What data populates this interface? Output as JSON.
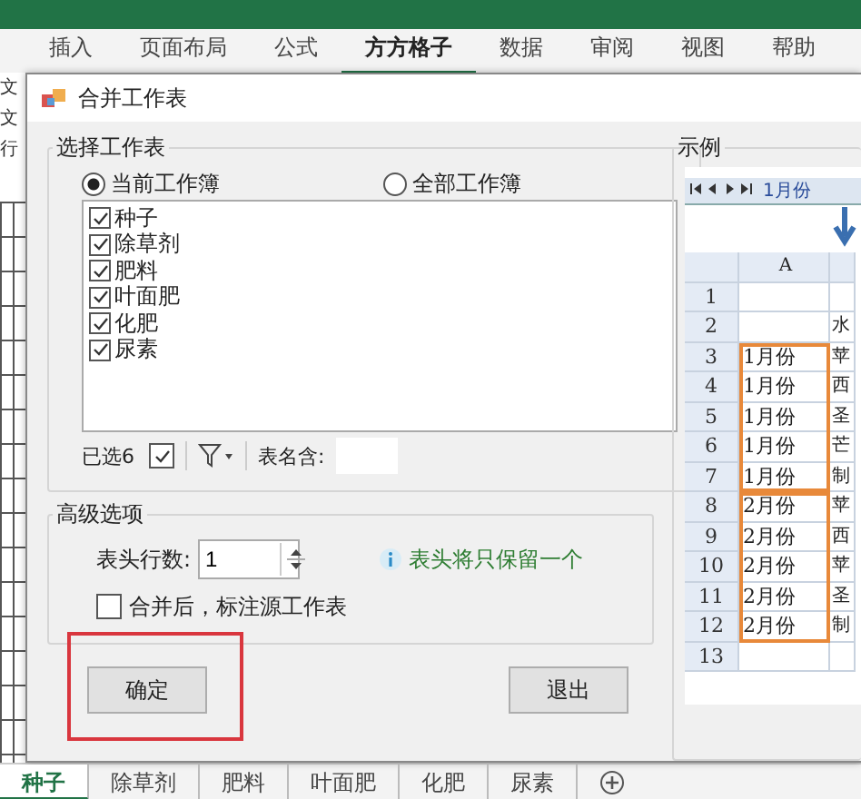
{
  "ribbon_tabs": [
    {
      "label": "插入",
      "selected": false
    },
    {
      "label": "页面布局",
      "selected": false
    },
    {
      "label": "公式",
      "selected": false
    },
    {
      "label": "方方格子",
      "selected": true
    },
    {
      "label": "数据",
      "selected": false
    },
    {
      "label": "审阅",
      "selected": false
    },
    {
      "label": "视图",
      "selected": false
    },
    {
      "label": "帮助",
      "selected": false
    }
  ],
  "side_chars": [
    "文",
    "文",
    "行"
  ],
  "dialog": {
    "title": "合并工作表",
    "select_group": {
      "title": "选择工作表",
      "scopes": [
        {
          "label": "当前工作簿",
          "selected": true
        },
        {
          "label": "全部工作簿",
          "selected": false
        }
      ],
      "sheets": [
        {
          "label": "种子",
          "checked": true
        },
        {
          "label": "除草剂",
          "checked": true
        },
        {
          "label": "肥料",
          "checked": true
        },
        {
          "label": "叶面肥",
          "checked": true
        },
        {
          "label": "化肥",
          "checked": true
        },
        {
          "label": "尿素",
          "checked": true
        }
      ],
      "selected_count": "已选6",
      "select_all_checked": true,
      "name_filter_label": "表名含:"
    },
    "advanced_group": {
      "title": "高级选项",
      "header_rows_label": "表头行数:",
      "header_rows_value": "1",
      "hint": "表头将只保留一个",
      "mark_source_label": "合并后，标注源工作表",
      "mark_source_checked": false
    },
    "buttons": [
      {
        "label": "确定",
        "highlighted": true
      },
      {
        "label": "退出",
        "highlighted": false
      }
    ],
    "example": {
      "title": "示例",
      "sheet_tab": "1月份",
      "column": "A",
      "sections": [
        {
          "framed": false,
          "rows": [
            {
              "num": "1"
            },
            {
              "num": "2",
              "b": "水"
            }
          ]
        },
        {
          "framed": true,
          "rows": [
            {
              "num": "3",
              "a": "1月份",
              "b": "苹"
            },
            {
              "num": "4",
              "a": "1月份",
              "b": "西"
            },
            {
              "num": "5",
              "a": "1月份",
              "b": "圣"
            },
            {
              "num": "6",
              "a": "1月份",
              "b": "芒"
            },
            {
              "num": "7",
              "a": "1月份",
              "b": "制"
            }
          ]
        },
        {
          "framed": true,
          "rows": [
            {
              "num": "8",
              "a": "2月份",
              "b": "苹"
            },
            {
              "num": "9",
              "a": "2月份",
              "b": "西"
            },
            {
              "num": "10",
              "a": "2月份",
              "b": "苹"
            },
            {
              "num": "11",
              "a": "2月份",
              "b": "圣"
            },
            {
              "num": "12",
              "a": "2月份",
              "b": "制"
            }
          ]
        },
        {
          "framed": false,
          "rows": [
            {
              "num": "13"
            }
          ]
        }
      ]
    }
  },
  "sheet_tabs": [
    {
      "label": "种子",
      "selected": true
    },
    {
      "label": "除草剂",
      "selected": false
    },
    {
      "label": "肥料",
      "selected": false
    },
    {
      "label": "叶面肥",
      "selected": false
    },
    {
      "label": "化肥",
      "selected": false
    },
    {
      "label": "尿素",
      "selected": false
    }
  ]
}
